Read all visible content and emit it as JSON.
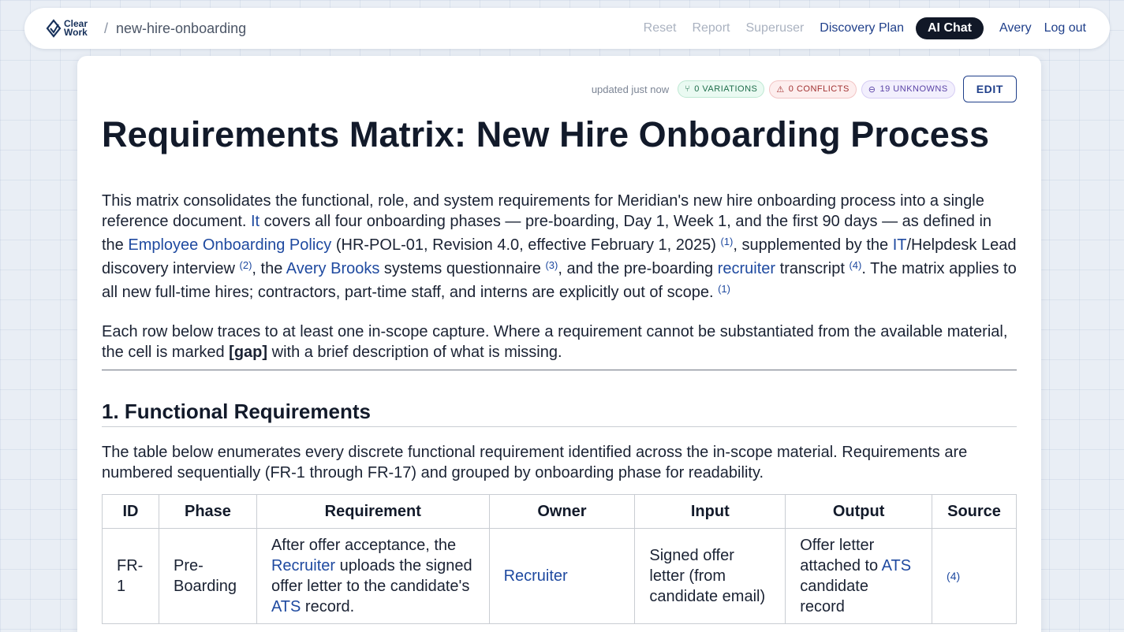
{
  "header": {
    "logo_text_1": "Clear",
    "logo_text_2": "Work",
    "separator": "/",
    "project": "new-hire-onboarding",
    "nav": {
      "reset": "Reset",
      "report": "Report",
      "superuser": "Superuser",
      "discovery_plan": "Discovery Plan",
      "ai_chat": "AI Chat",
      "user": "Avery",
      "logout": "Log out"
    }
  },
  "doc": {
    "updated": "updated just now",
    "badges": {
      "variations": "0 VARIATIONS",
      "conflicts": "0 CONFLICTS",
      "unknowns": "19 UNKNOWNS"
    },
    "edit_label": "EDIT",
    "title": "Requirements Matrix: New Hire Onboarding Process",
    "intro": {
      "t1": "This matrix consolidates the functional, role, and system requirements for Meridian's new hire onboarding process into a single reference document. ",
      "l1": "It",
      "t2": " covers all four onboarding phases — pre-boarding, Day 1, Week 1, and the first 90 days — as defined in the ",
      "l2": "Employee Onboarding Policy",
      "t3": " (HR-POL-01, Revision 4.0, effective February 1, 2025) ",
      "r1": "(1)",
      "t4": ", supplemented by the ",
      "l3": "IT",
      "t5": "/Helpdesk Lead discovery interview ",
      "r2": "(2)",
      "t6": ", the ",
      "l4": "Avery Brooks",
      "t7": " systems questionnaire ",
      "r3": "(3)",
      "t8": ", and the pre-boarding ",
      "l5": "recruiter",
      "t9": " transcript ",
      "r4": "(4)",
      "t10": ". The matrix applies to all new full-time hires; contractors, part-time staff, and interns are explicitly out of scope. ",
      "r5": "(1)"
    },
    "para2": {
      "t1": "Each row below traces to at least one in-scope capture. Where a requirement cannot be substantiated from the available material, the cell is marked ",
      "gap": "[gap]",
      "t2": " with a brief description of what is missing."
    },
    "section1": {
      "heading": "1. Functional Requirements",
      "intro": "The table below enumerates every discrete functional requirement identified across the in-scope material. Requirements are numbered sequentially (FR-1 through FR-17) and grouped by onboarding phase for readability."
    },
    "table": {
      "headers": [
        "ID",
        "Phase",
        "Requirement",
        "Owner",
        "Input",
        "Output",
        "Source"
      ],
      "rows": [
        {
          "id": "FR-1",
          "phase": "Pre-Boarding",
          "req_t1": "After offer acceptance, the ",
          "req_l1": "Recruiter",
          "req_t2": " uploads the signed offer letter to the candidate's ",
          "req_l2": "ATS",
          "req_t3": " record.",
          "owner": "Recruiter",
          "input": "Signed offer letter (from candidate email)",
          "out_t1": "Offer letter attached to ",
          "out_l1": "ATS",
          "out_t2": " candidate record",
          "source": "(4)"
        }
      ]
    }
  }
}
